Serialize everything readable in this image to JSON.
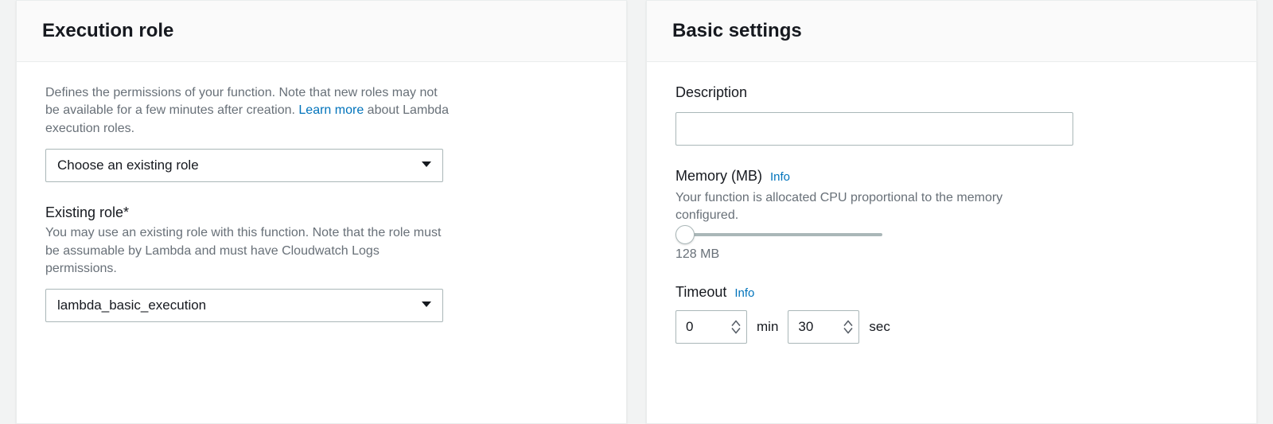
{
  "executionRole": {
    "heading": "Execution role",
    "description_pre": "Defines the permissions of your function. Note that new roles may not be available for a few minutes after creation. ",
    "learn_more": "Learn more",
    "description_post": " about Lambda execution roles.",
    "role_select_value": "Choose an existing role",
    "existing_role_label": "Existing role*",
    "existing_role_hint": "You may use an existing role with this function. Note that the role must be assumable by Lambda and must have Cloudwatch Logs permissions.",
    "existing_role_value": "lambda_basic_execution"
  },
  "basicSettings": {
    "heading": "Basic settings",
    "description_label": "Description",
    "description_value": "",
    "memory_label": "Memory (MB)",
    "memory_info": "Info",
    "memory_hint": "Your function is allocated CPU proportional to the memory configured.",
    "memory_value": "128 MB",
    "timeout_label": "Timeout",
    "timeout_info": "Info",
    "timeout_min_value": "0",
    "timeout_min_unit": "min",
    "timeout_sec_value": "30",
    "timeout_sec_unit": "sec"
  }
}
